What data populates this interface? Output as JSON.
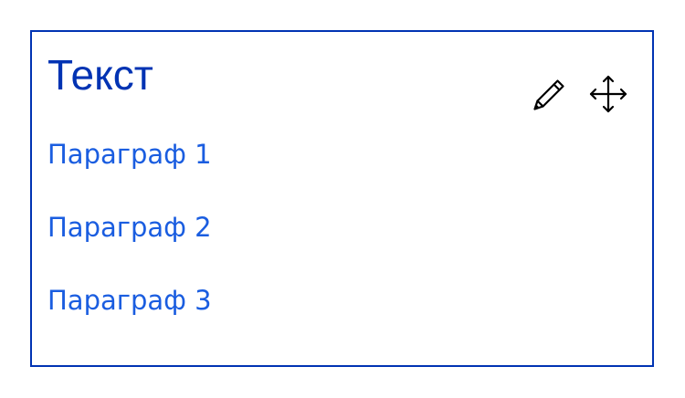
{
  "card": {
    "title": "Текст",
    "paragraphs": [
      {
        "label": "Параграф 1"
      },
      {
        "label": "Параграф 2"
      },
      {
        "label": "Параграф 3"
      }
    ],
    "actions": [
      {
        "icon": "pencil-icon"
      },
      {
        "icon": "move-icon"
      }
    ]
  },
  "colors": {
    "border": "#0033b3",
    "title": "#0033b3",
    "paragraph": "#1a5de0",
    "icon": "#000000"
  }
}
